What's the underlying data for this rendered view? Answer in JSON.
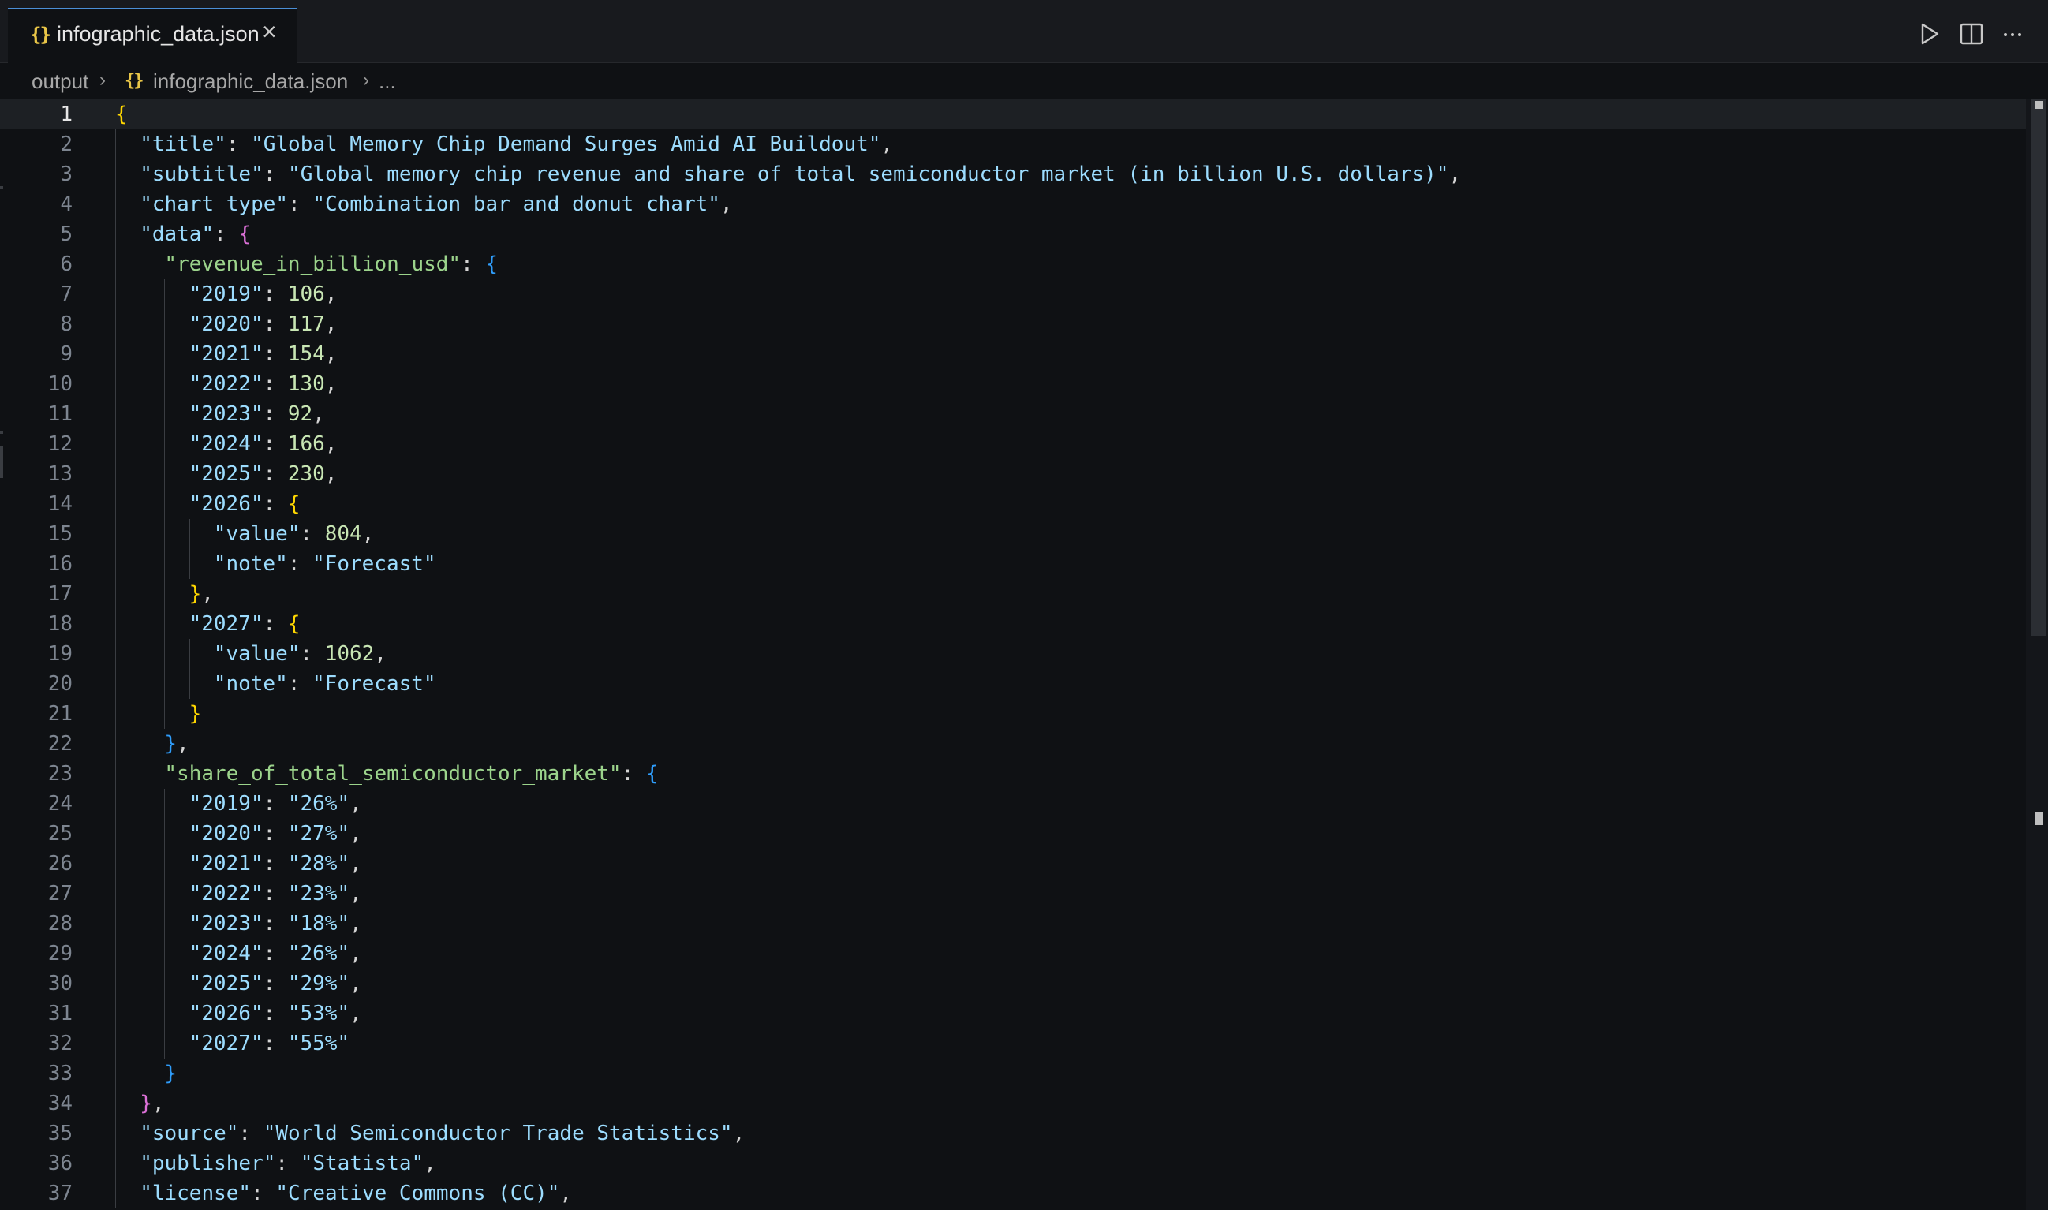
{
  "tab": {
    "icon": "{}",
    "label": "infographic_data.json",
    "close": "×"
  },
  "breadcrumb": {
    "folder": "output",
    "icon": "{}",
    "file": "infographic_data.json",
    "more": "..."
  },
  "actions": [
    "run-icon",
    "split-editor-icon",
    "more-actions-icon"
  ],
  "colors": {
    "accent": "#4b8fd6",
    "json_icon": "#e8c547",
    "background": "#0f1114"
  },
  "lines": [
    {
      "n": "1",
      "indent": 0,
      "parts": [
        [
          "b1",
          "{"
        ]
      ]
    },
    {
      "n": "2",
      "indent": 1,
      "parts": [
        [
          "k",
          "\"title\""
        ],
        [
          "p",
          ": "
        ],
        [
          "s",
          "\"Global Memory Chip Demand Surges Amid AI Buildout\""
        ],
        [
          "p",
          ","
        ]
      ]
    },
    {
      "n": "3",
      "indent": 1,
      "parts": [
        [
          "k",
          "\"subtitle\""
        ],
        [
          "p",
          ": "
        ],
        [
          "s",
          "\"Global memory chip revenue and share of total semiconductor market (in billion U.S. dollars)\""
        ],
        [
          "p",
          ","
        ]
      ]
    },
    {
      "n": "4",
      "indent": 1,
      "parts": [
        [
          "k",
          "\"chart_type\""
        ],
        [
          "p",
          ": "
        ],
        [
          "s",
          "\"Combination bar and donut chart\""
        ],
        [
          "p",
          ","
        ]
      ]
    },
    {
      "n": "5",
      "indent": 1,
      "parts": [
        [
          "k",
          "\"data\""
        ],
        [
          "p",
          ": "
        ],
        [
          "b2",
          "{"
        ]
      ]
    },
    {
      "n": "6",
      "indent": 2,
      "parts": [
        [
          "k2",
          "\"revenue_in_billion_usd\""
        ],
        [
          "p",
          ": "
        ],
        [
          "b3",
          "{"
        ]
      ]
    },
    {
      "n": "7",
      "indent": 3,
      "parts": [
        [
          "s",
          "\"2019\""
        ],
        [
          "p",
          ": "
        ],
        [
          "n",
          "106"
        ],
        [
          "p",
          ","
        ]
      ]
    },
    {
      "n": "8",
      "indent": 3,
      "parts": [
        [
          "s",
          "\"2020\""
        ],
        [
          "p",
          ": "
        ],
        [
          "n",
          "117"
        ],
        [
          "p",
          ","
        ]
      ]
    },
    {
      "n": "9",
      "indent": 3,
      "parts": [
        [
          "s",
          "\"2021\""
        ],
        [
          "p",
          ": "
        ],
        [
          "n",
          "154"
        ],
        [
          "p",
          ","
        ]
      ]
    },
    {
      "n": "10",
      "indent": 3,
      "parts": [
        [
          "s",
          "\"2022\""
        ],
        [
          "p",
          ": "
        ],
        [
          "n",
          "130"
        ],
        [
          "p",
          ","
        ]
      ]
    },
    {
      "n": "11",
      "indent": 3,
      "parts": [
        [
          "s",
          "\"2023\""
        ],
        [
          "p",
          ": "
        ],
        [
          "n",
          "92"
        ],
        [
          "p",
          ","
        ]
      ]
    },
    {
      "n": "12",
      "indent": 3,
      "parts": [
        [
          "s",
          "\"2024\""
        ],
        [
          "p",
          ": "
        ],
        [
          "n",
          "166"
        ],
        [
          "p",
          ","
        ]
      ]
    },
    {
      "n": "13",
      "indent": 3,
      "parts": [
        [
          "s",
          "\"2025\""
        ],
        [
          "p",
          ": "
        ],
        [
          "n",
          "230"
        ],
        [
          "p",
          ","
        ]
      ]
    },
    {
      "n": "14",
      "indent": 3,
      "parts": [
        [
          "s",
          "\"2026\""
        ],
        [
          "p",
          ": "
        ],
        [
          "b1",
          "{"
        ]
      ]
    },
    {
      "n": "15",
      "indent": 4,
      "parts": [
        [
          "s",
          "\"value\""
        ],
        [
          "p",
          ": "
        ],
        [
          "n",
          "804"
        ],
        [
          "p",
          ","
        ]
      ]
    },
    {
      "n": "16",
      "indent": 4,
      "parts": [
        [
          "s",
          "\"note\""
        ],
        [
          "p",
          ": "
        ],
        [
          "s",
          "\"Forecast\""
        ]
      ]
    },
    {
      "n": "17",
      "indent": 3,
      "parts": [
        [
          "b1",
          "}"
        ],
        [
          "p",
          ","
        ]
      ]
    },
    {
      "n": "18",
      "indent": 3,
      "parts": [
        [
          "s",
          "\"2027\""
        ],
        [
          "p",
          ": "
        ],
        [
          "b1",
          "{"
        ]
      ]
    },
    {
      "n": "19",
      "indent": 4,
      "parts": [
        [
          "s",
          "\"value\""
        ],
        [
          "p",
          ": "
        ],
        [
          "n",
          "1062"
        ],
        [
          "p",
          ","
        ]
      ]
    },
    {
      "n": "20",
      "indent": 4,
      "parts": [
        [
          "s",
          "\"note\""
        ],
        [
          "p",
          ": "
        ],
        [
          "s",
          "\"Forecast\""
        ]
      ]
    },
    {
      "n": "21",
      "indent": 3,
      "parts": [
        [
          "b1",
          "}"
        ]
      ]
    },
    {
      "n": "22",
      "indent": 2,
      "parts": [
        [
          "b3",
          "}"
        ],
        [
          "p",
          ","
        ]
      ]
    },
    {
      "n": "23",
      "indent": 2,
      "parts": [
        [
          "k2",
          "\"share_of_total_semiconductor_market\""
        ],
        [
          "p",
          ": "
        ],
        [
          "b3",
          "{"
        ]
      ]
    },
    {
      "n": "24",
      "indent": 3,
      "parts": [
        [
          "s",
          "\"2019\""
        ],
        [
          "p",
          ": "
        ],
        [
          "s",
          "\"26%\""
        ],
        [
          "p",
          ","
        ]
      ]
    },
    {
      "n": "25",
      "indent": 3,
      "parts": [
        [
          "s",
          "\"2020\""
        ],
        [
          "p",
          ": "
        ],
        [
          "s",
          "\"27%\""
        ],
        [
          "p",
          ","
        ]
      ]
    },
    {
      "n": "26",
      "indent": 3,
      "parts": [
        [
          "s",
          "\"2021\""
        ],
        [
          "p",
          ": "
        ],
        [
          "s",
          "\"28%\""
        ],
        [
          "p",
          ","
        ]
      ]
    },
    {
      "n": "27",
      "indent": 3,
      "parts": [
        [
          "s",
          "\"2022\""
        ],
        [
          "p",
          ": "
        ],
        [
          "s",
          "\"23%\""
        ],
        [
          "p",
          ","
        ]
      ]
    },
    {
      "n": "28",
      "indent": 3,
      "parts": [
        [
          "s",
          "\"2023\""
        ],
        [
          "p",
          ": "
        ],
        [
          "s",
          "\"18%\""
        ],
        [
          "p",
          ","
        ]
      ]
    },
    {
      "n": "29",
      "indent": 3,
      "parts": [
        [
          "s",
          "\"2024\""
        ],
        [
          "p",
          ": "
        ],
        [
          "s",
          "\"26%\""
        ],
        [
          "p",
          ","
        ]
      ]
    },
    {
      "n": "30",
      "indent": 3,
      "parts": [
        [
          "s",
          "\"2025\""
        ],
        [
          "p",
          ": "
        ],
        [
          "s",
          "\"29%\""
        ],
        [
          "p",
          ","
        ]
      ]
    },
    {
      "n": "31",
      "indent": 3,
      "parts": [
        [
          "s",
          "\"2026\""
        ],
        [
          "p",
          ": "
        ],
        [
          "s",
          "\"53%\""
        ],
        [
          "p",
          ","
        ]
      ]
    },
    {
      "n": "32",
      "indent": 3,
      "parts": [
        [
          "s",
          "\"2027\""
        ],
        [
          "p",
          ": "
        ],
        [
          "s",
          "\"55%\""
        ]
      ]
    },
    {
      "n": "33",
      "indent": 2,
      "parts": [
        [
          "b3",
          "}"
        ]
      ]
    },
    {
      "n": "34",
      "indent": 1,
      "parts": [
        [
          "b2",
          "}"
        ],
        [
          "p",
          ","
        ]
      ]
    },
    {
      "n": "35",
      "indent": 1,
      "parts": [
        [
          "k",
          "\"source\""
        ],
        [
          "p",
          ": "
        ],
        [
          "s",
          "\"World Semiconductor Trade Statistics\""
        ],
        [
          "p",
          ","
        ]
      ]
    },
    {
      "n": "36",
      "indent": 1,
      "parts": [
        [
          "k",
          "\"publisher\""
        ],
        [
          "p",
          ": "
        ],
        [
          "s",
          "\"Statista\""
        ],
        [
          "p",
          ","
        ]
      ]
    },
    {
      "n": "37",
      "indent": 1,
      "parts": [
        [
          "k",
          "\"license\""
        ],
        [
          "p",
          ": "
        ],
        [
          "s",
          "\"Creative Commons (CC)\""
        ],
        [
          "p",
          ","
        ]
      ]
    }
  ]
}
